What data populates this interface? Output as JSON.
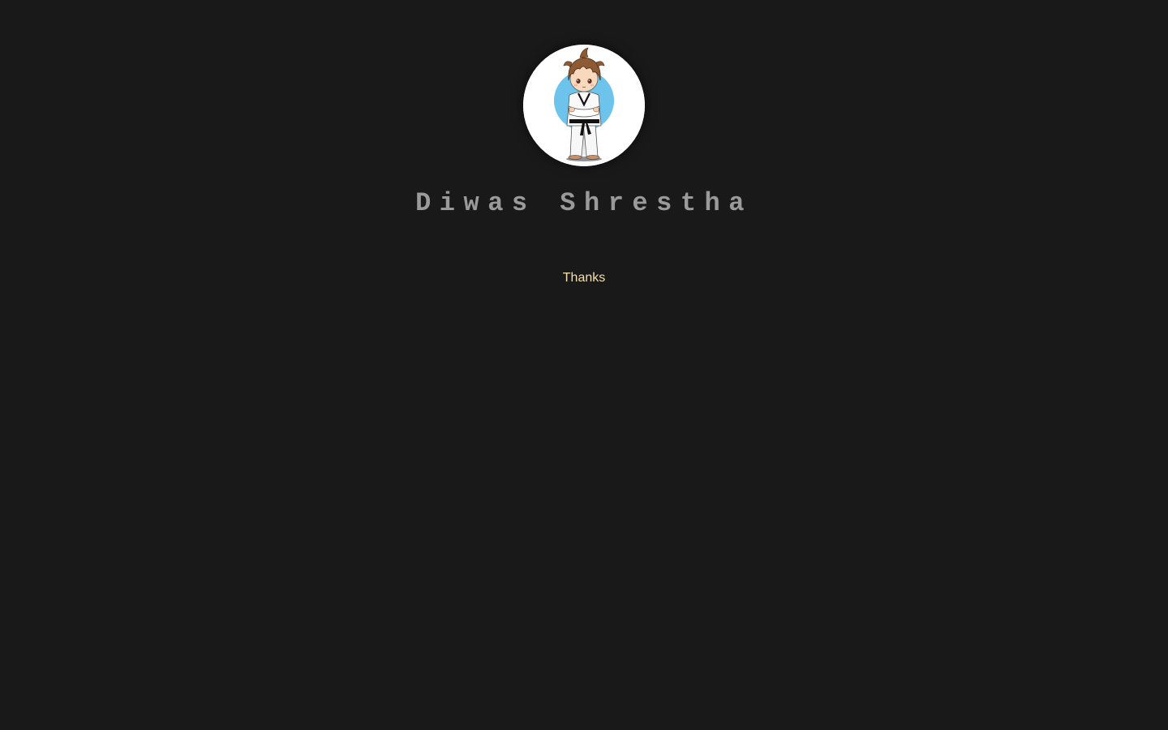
{
  "profile": {
    "name": "Diwas Shrestha",
    "avatar_icon": "karate-boy-avatar-icon",
    "avatar_background_color": "#ffffff",
    "avatar_circle_color": "#6cc3ec"
  },
  "content": {
    "link_label": "Thanks",
    "link_color": "#f3dfb0"
  },
  "theme": {
    "background_color": "#191919",
    "name_color": "#9a9a9a"
  }
}
